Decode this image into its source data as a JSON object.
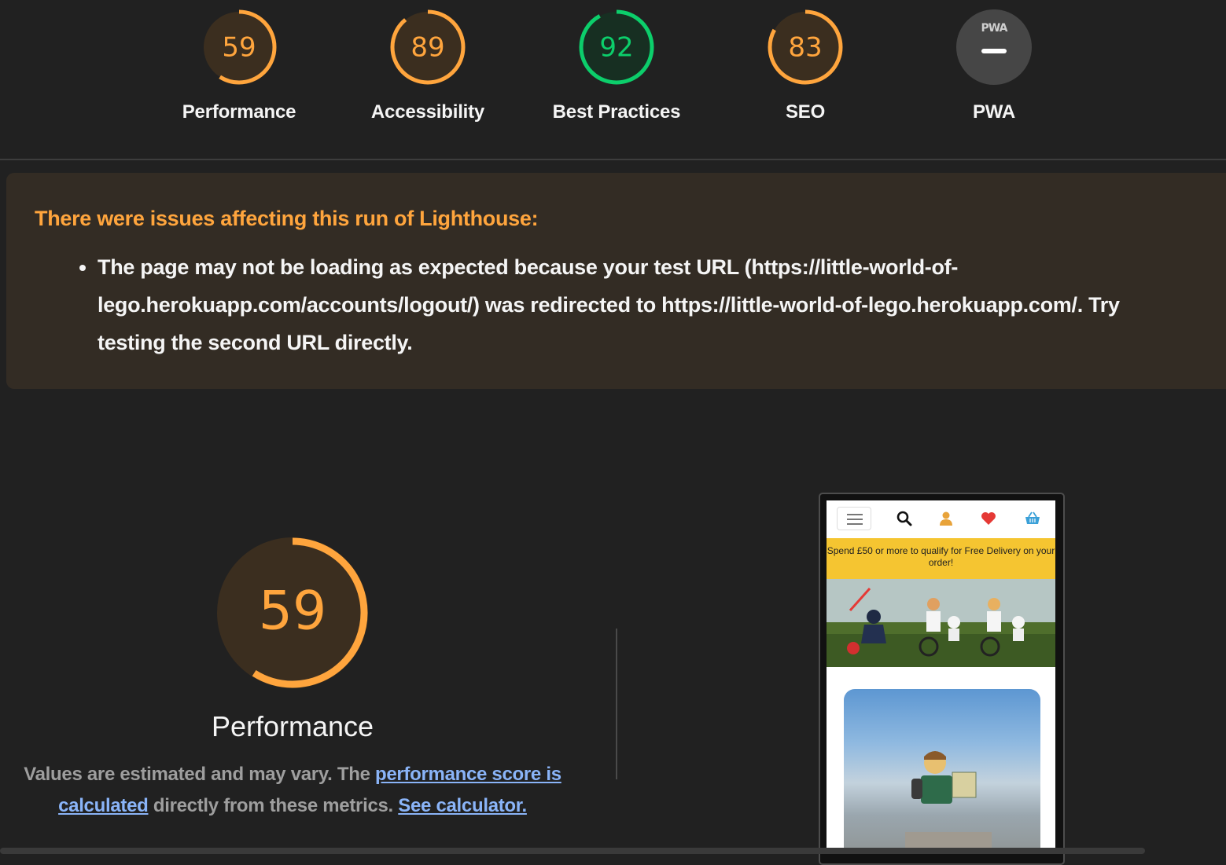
{
  "categories": [
    {
      "id": "performance",
      "label": "Performance",
      "score": "59",
      "fraction": 0.59,
      "color": "#ffa53d",
      "bg": "#3b2e1f"
    },
    {
      "id": "accessibility",
      "label": "Accessibility",
      "score": "89",
      "fraction": 0.89,
      "color": "#ffa53d",
      "bg": "#3b2e1f"
    },
    {
      "id": "best-practices",
      "label": "Best Practices",
      "score": "92",
      "fraction": 0.92,
      "color": "#0cce6b",
      "bg": "#172f22"
    },
    {
      "id": "seo",
      "label": "SEO",
      "score": "83",
      "fraction": 0.83,
      "color": "#ffa53d",
      "bg": "#3b2e1f"
    },
    {
      "id": "pwa",
      "label": "PWA",
      "badge": "PWA",
      "score": "–",
      "color": "#cfcfcf",
      "bg": "#464646"
    }
  ],
  "warning": {
    "title": "There were issues affecting this run of Lighthouse:",
    "items": [
      "The page may not be loading as expected because your test URL (https://little-world-of-lego.herokuapp.com/accounts/logout/) was redirected to https://little-world-of-lego.herokuapp.com/. Try testing the second URL directly."
    ]
  },
  "performance": {
    "score": "59",
    "fraction": 0.59,
    "title": "Performance",
    "desc_prefix": "Values are estimated and may vary. The ",
    "link1": "performance score is calculated",
    "desc_middle": " directly from these metrics. ",
    "link2": "See calculator."
  },
  "screenshot": {
    "banner": "Spend £50 or more to qualify for Free Delivery on your order!"
  }
}
